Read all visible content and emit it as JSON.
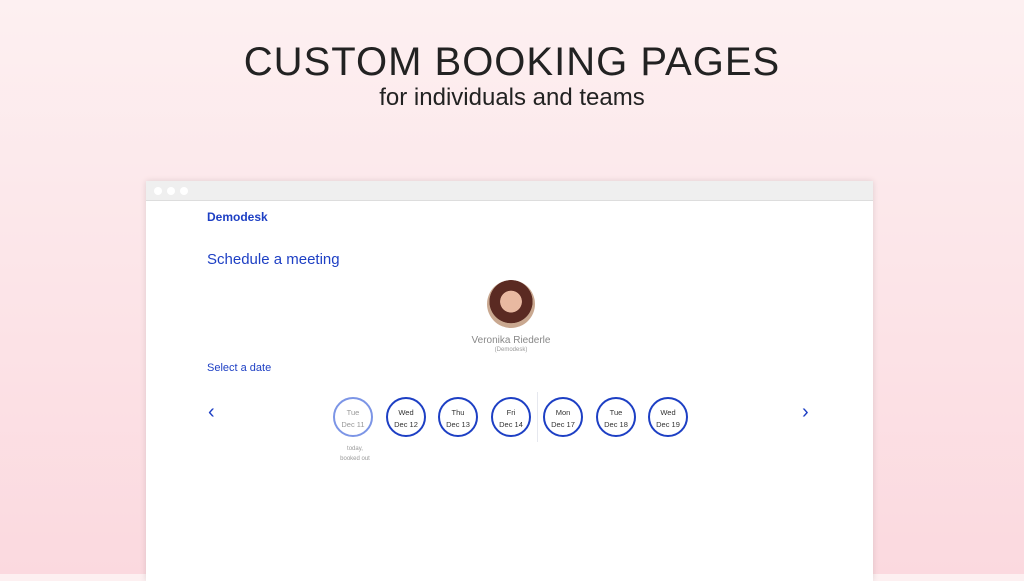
{
  "hero": {
    "title": "CUSTOM BOOKING PAGES",
    "subtitle": "for individuals and teams"
  },
  "page": {
    "logo": "Demodesk",
    "title": "Schedule a meeting",
    "host_name": "Veronika Riederle",
    "host_org": "(Demodesk)",
    "select_label": "Select a date",
    "days": [
      {
        "day": "Tue",
        "date": "Dec 11",
        "note1": "today,",
        "note2": "booked out"
      },
      {
        "day": "Wed",
        "date": "Dec 12"
      },
      {
        "day": "Thu",
        "date": "Dec 13"
      },
      {
        "day": "Fri",
        "date": "Dec 14"
      },
      {
        "day": "Mon",
        "date": "Dec 17"
      },
      {
        "day": "Tue",
        "date": "Dec 18"
      },
      {
        "day": "Wed",
        "date": "Dec 19"
      }
    ],
    "prev": "‹",
    "next": "›"
  }
}
